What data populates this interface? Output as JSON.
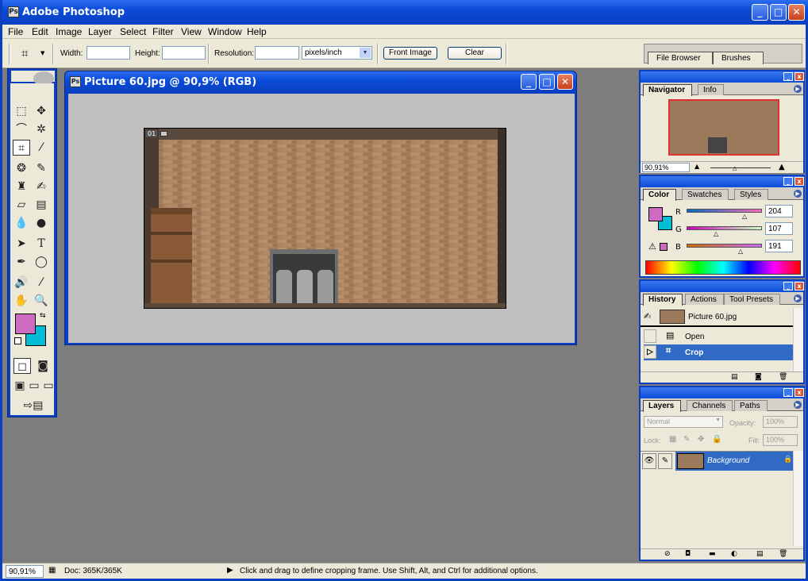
{
  "app": {
    "title": "Adobe Photoshop"
  },
  "menu": [
    "File",
    "Edit",
    "Image",
    "Layer",
    "Select",
    "Filter",
    "View",
    "Window",
    "Help"
  ],
  "options": {
    "width_label": "Width:",
    "height_label": "Height:",
    "resolution_label": "Resolution:",
    "units_value": "pixels/inch",
    "front_image_label": "Front Image",
    "clear_label": "Clear",
    "width_value": "",
    "height_value": "",
    "resolution_value": ""
  },
  "well_tabs": [
    "File Browser",
    "Brushes"
  ],
  "document": {
    "title": "Picture 60.jpg @ 90,9% (RGB)",
    "slice_label": "01"
  },
  "navigator": {
    "tabs": [
      "Navigator",
      "Info"
    ],
    "zoom": "90,91%"
  },
  "color": {
    "tabs": [
      "Color",
      "Swatches",
      "Styles"
    ],
    "foreground_hex": "#cc6bbf",
    "background_hex": "#00bcd4",
    "channels": [
      {
        "name": "R",
        "value": "204"
      },
      {
        "name": "G",
        "value": "107"
      },
      {
        "name": "B",
        "value": "191"
      }
    ]
  },
  "history": {
    "tabs": [
      "History",
      "Actions",
      "Tool Presets"
    ],
    "snapshot": "Picture 60.jpg",
    "items": [
      "Open",
      "Crop"
    ]
  },
  "layers": {
    "tabs": [
      "Layers",
      "Channels",
      "Paths"
    ],
    "blend_mode": "Normal",
    "opacity_label": "Opacity:",
    "opacity_value": "100%",
    "lock_label": "Lock:",
    "fill_label": "Fill:",
    "fill_value": "100%",
    "layer_name": "Background"
  },
  "status": {
    "zoom": "90,91%",
    "doc": "Doc: 365K/365K",
    "hint": "Click and drag to define cropping frame. Use Shift, Alt, and Ctrl for additional options."
  }
}
